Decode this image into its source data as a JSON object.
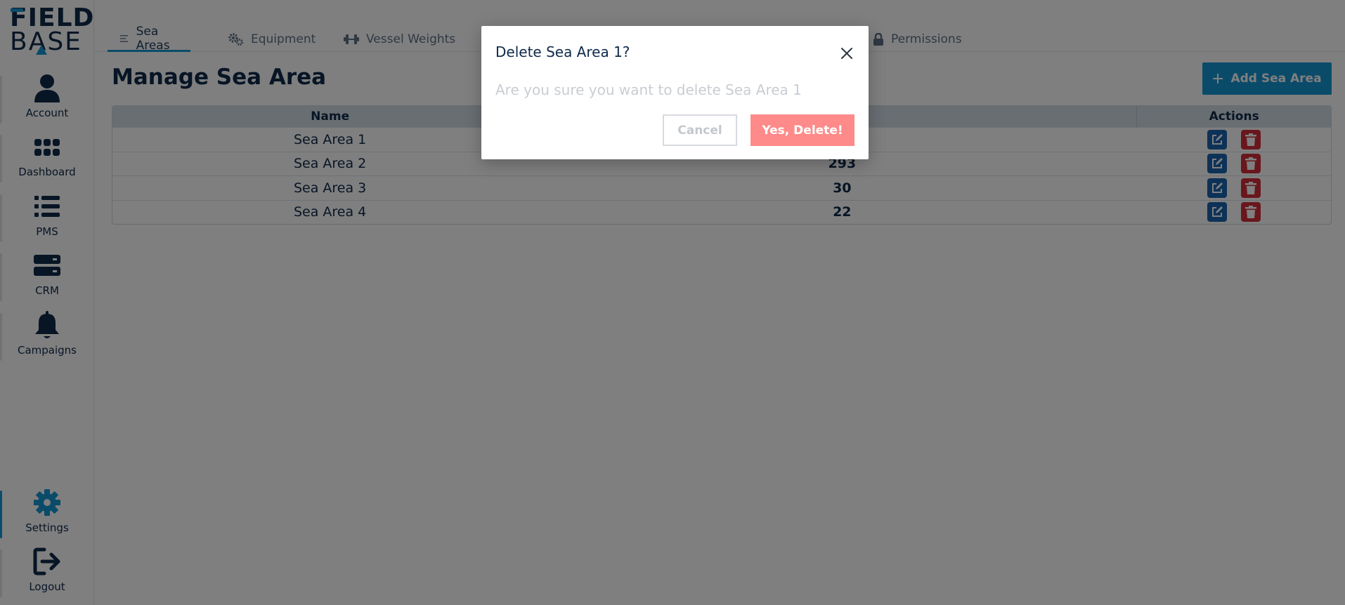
{
  "app": {
    "logo_line1": "FIELD",
    "logo_line2": "BASE"
  },
  "sidebar": {
    "items": [
      {
        "label": "Account",
        "icon": "user-icon"
      },
      {
        "label": "Dashboard",
        "icon": "grid-dots-icon"
      },
      {
        "label": "PMS",
        "icon": "list-icon"
      },
      {
        "label": "CRM",
        "icon": "server-icon"
      },
      {
        "label": "Campaigns",
        "icon": "bell-icon"
      },
      {
        "label": "Settings",
        "icon": "gear-icon",
        "active": true
      },
      {
        "label": "Logout",
        "icon": "logout-icon"
      }
    ]
  },
  "tabs": [
    {
      "label": "Sea Areas",
      "icon": "list-lines-icon",
      "active": true
    },
    {
      "label": "Equipment",
      "icon": "gears-icon"
    },
    {
      "label": "Vessel Weights",
      "icon": "dumbbell-icon"
    },
    {
      "label": "Permissions",
      "icon": "lock-icon"
    }
  ],
  "main": {
    "title": "Manage Sea Area",
    "add_button": "Add Sea Area"
  },
  "table": {
    "headers": {
      "name": "Name",
      "actions": "Actions"
    },
    "rows": [
      {
        "name": "Sea Area 1",
        "value": ""
      },
      {
        "name": "Sea Area 2",
        "value": "293"
      },
      {
        "name": "Sea Area 3",
        "value": "30"
      },
      {
        "name": "Sea Area 4",
        "value": "22"
      }
    ]
  },
  "modal": {
    "title": "Delete Sea Area 1?",
    "message": "Are you sure you want to delete Sea Area 1",
    "cancel": "Cancel",
    "confirm": "Yes, Delete!"
  },
  "colors": {
    "primary": "#1797d4",
    "navy": "#0f2a4a",
    "edit": "#1a64b0",
    "delete": "#d32f3b",
    "confirm": "#ff8a8a"
  }
}
